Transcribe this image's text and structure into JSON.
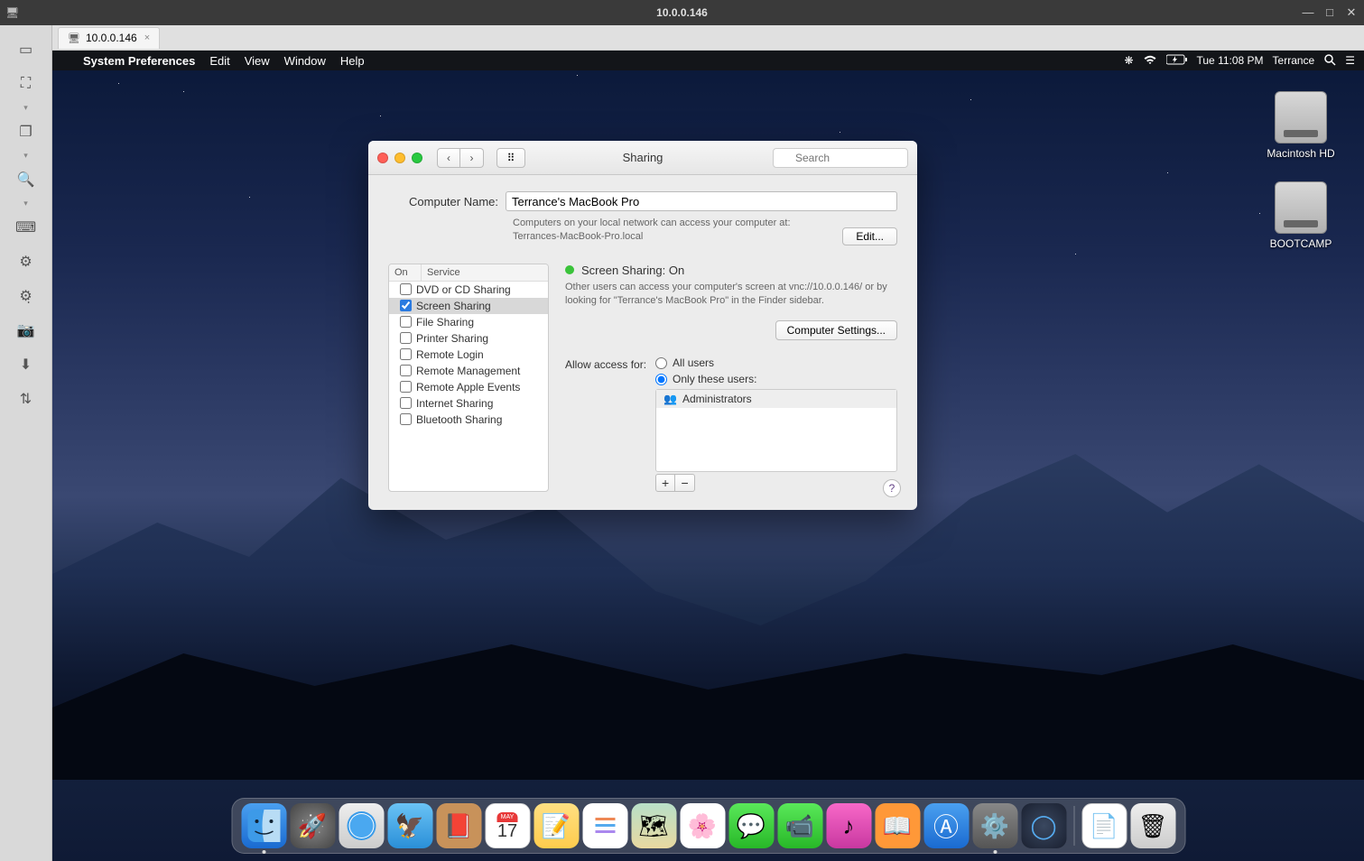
{
  "host": {
    "title": "10.0.0.146",
    "tab_label": "10.0.0.146",
    "tab_close": "×"
  },
  "menubar": {
    "app": "System Preferences",
    "items": [
      "Edit",
      "View",
      "Window",
      "Help"
    ],
    "time": "Tue 11:08 PM",
    "user": "Terrance"
  },
  "desktop_icons": {
    "hd": "Macintosh HD",
    "bootcamp": "BOOTCAMP"
  },
  "pref": {
    "window_title": "Sharing",
    "search_placeholder": "Search",
    "computer_name_label": "Computer Name:",
    "computer_name_value": "Terrance's MacBook Pro",
    "local_help_line1": "Computers on your local network can access your computer at:",
    "local_help_line2": "Terrances-MacBook-Pro.local",
    "edit_btn": "Edit...",
    "table_head_on": "On",
    "table_head_service": "Service",
    "services": [
      {
        "label": "DVD or CD Sharing",
        "checked": false
      },
      {
        "label": "Screen Sharing",
        "checked": true
      },
      {
        "label": "File Sharing",
        "checked": false
      },
      {
        "label": "Printer Sharing",
        "checked": false
      },
      {
        "label": "Remote Login",
        "checked": false
      },
      {
        "label": "Remote Management",
        "checked": false
      },
      {
        "label": "Remote Apple Events",
        "checked": false
      },
      {
        "label": "Internet Sharing",
        "checked": false
      },
      {
        "label": "Bluetooth Sharing",
        "checked": false
      }
    ],
    "status_title": "Screen Sharing: On",
    "status_help": "Other users can access your computer's screen at vnc://10.0.0.146/ or by looking for \"Terrance's MacBook Pro\" in the Finder sidebar.",
    "computer_settings_btn": "Computer Settings...",
    "access_label": "Allow access for:",
    "radio_all": "All users",
    "radio_only": "Only these users:",
    "user_entry": "Administrators",
    "plus": "+",
    "minus": "−",
    "help_q": "?"
  },
  "calendar": {
    "month": "MAY",
    "day": "17"
  }
}
